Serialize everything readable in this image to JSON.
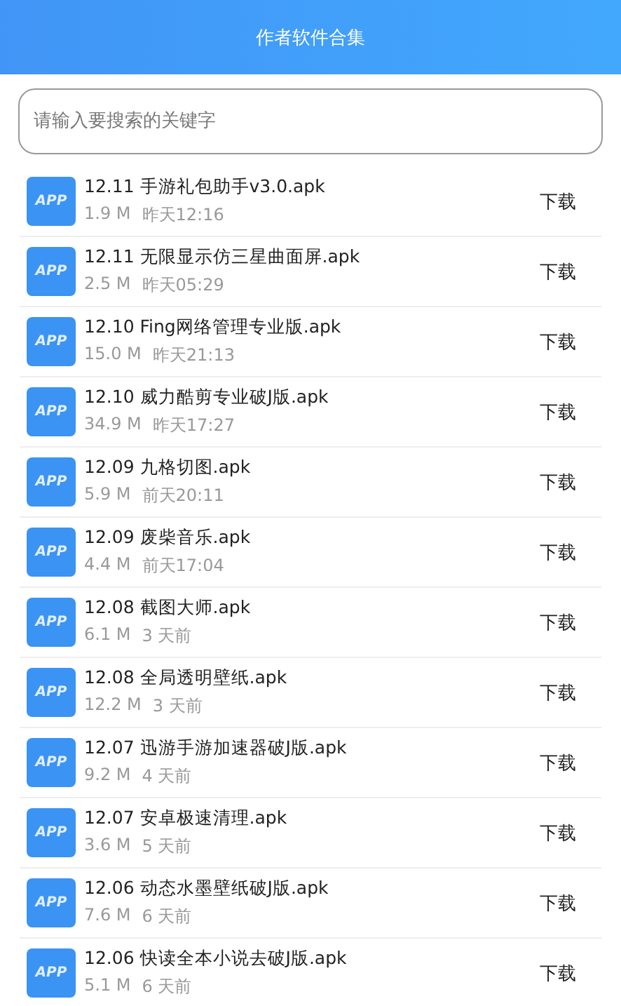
{
  "header": {
    "title": "作者软件合集"
  },
  "search": {
    "placeholder": "请输入要搜索的关键字"
  },
  "files": [
    {
      "icon_label": "APP",
      "name": "12.11 手游礼包助手v3.0.apk",
      "size": "1.9 M",
      "time": "昨天12:16",
      "action": "下载"
    },
    {
      "icon_label": "APP",
      "name": "12.11 无限显示仿三星曲面屏.apk",
      "size": "2.5 M",
      "time": "昨天05:29",
      "action": "下载"
    },
    {
      "icon_label": "APP",
      "name": "12.10 Fing网络管理专业版.apk",
      "size": "15.0 M",
      "time": "昨天21:13",
      "action": "下载"
    },
    {
      "icon_label": "APP",
      "name": "12.10 威力酷剪专业破J版.apk",
      "size": "34.9 M",
      "time": "昨天17:27",
      "action": "下载"
    },
    {
      "icon_label": "APP",
      "name": "12.09 九格切图.apk",
      "size": "5.9 M",
      "time": "前天20:11",
      "action": "下载"
    },
    {
      "icon_label": "APP",
      "name": "12.09 废柴音乐.apk",
      "size": "4.4 M",
      "time": "前天17:04",
      "action": "下载"
    },
    {
      "icon_label": "APP",
      "name": "12.08 截图大师.apk",
      "size": "6.1 M",
      "time": "3 天前",
      "action": "下载"
    },
    {
      "icon_label": "APP",
      "name": "12.08 全局透明壁纸.apk",
      "size": "12.2 M",
      "time": "3 天前",
      "action": "下载"
    },
    {
      "icon_label": "APP",
      "name": "12.07 迅游手游加速器破J版.apk",
      "size": "9.2 M",
      "time": "4 天前",
      "action": "下载"
    },
    {
      "icon_label": "APP",
      "name": "12.07 安卓极速清理.apk",
      "size": "3.6 M",
      "time": "5 天前",
      "action": "下载"
    },
    {
      "icon_label": "APP",
      "name": "12.06 动态水墨壁纸破J版.apk",
      "size": "7.6 M",
      "time": "6 天前",
      "action": "下载"
    },
    {
      "icon_label": "APP",
      "name": "12.06 快读全本小说去破J版.apk",
      "size": "5.1 M",
      "time": "6 天前",
      "action": "下载"
    }
  ]
}
